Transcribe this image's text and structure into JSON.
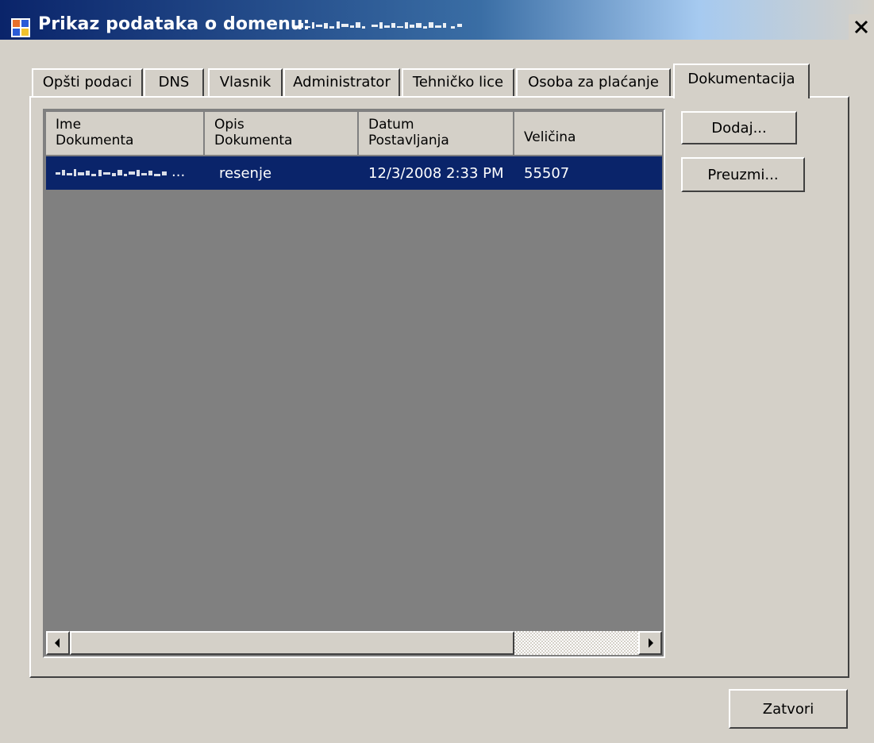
{
  "window": {
    "title": "Prikaz podataka o domenu:",
    "close_symbol": "×"
  },
  "tabs": [
    {
      "label": "Opšti podaci",
      "active": false
    },
    {
      "label": "DNS",
      "active": false
    },
    {
      "label": "Vlasnik",
      "active": false
    },
    {
      "label": "Administrator",
      "active": false
    },
    {
      "label": "Tehničko lice",
      "active": false
    },
    {
      "label": "Osoba za plaćanje",
      "active": false
    },
    {
      "label": "Dokumentacija",
      "active": true
    }
  ],
  "documents_table": {
    "columns": [
      {
        "line1": "Ime",
        "line2": "Dokumenta"
      },
      {
        "line1": "Opis",
        "line2": "Dokumenta"
      },
      {
        "line1": "Datum",
        "line2": "Postavljanja"
      },
      {
        "line1": "Veličina",
        "line2": ""
      }
    ],
    "rows": [
      {
        "name_suffix": "...",
        "description": "resenje",
        "date": "12/3/2008 2:33 PM",
        "size": "55507",
        "selected": true
      }
    ]
  },
  "buttons": {
    "add": "Dodaj...",
    "download": "Preuzmi...",
    "close": "Zatvori"
  },
  "icons": {
    "app": "app-window-icon",
    "close": "close-icon",
    "scroll_left": "arrow-left-icon",
    "scroll_right": "arrow-right-icon"
  },
  "colors": {
    "title_bar": "#0a246a",
    "selection": "#0a246a",
    "window_face": "#d4d0c8",
    "list_background": "#808080"
  }
}
